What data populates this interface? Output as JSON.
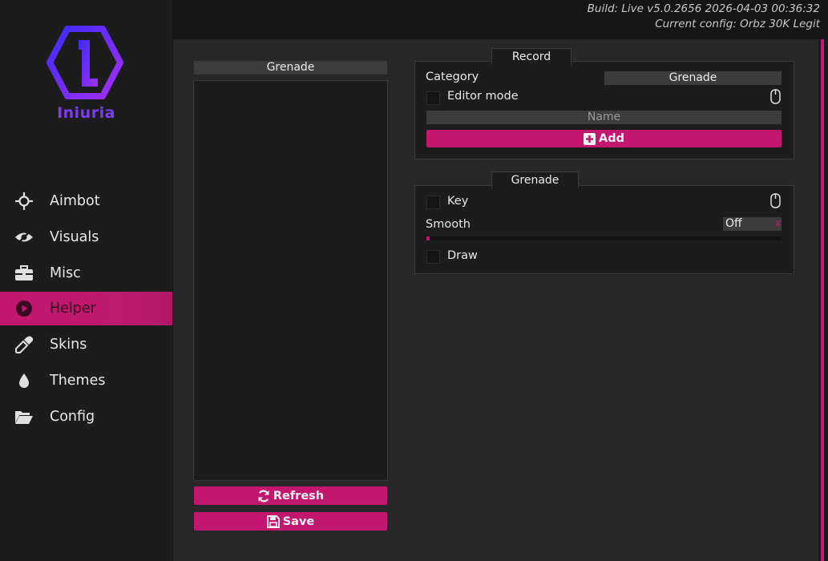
{
  "header": {
    "build_line": "Build: Live v5.0.2656 2026-04-03 00:36:32",
    "config_line": "Current config: Orbz 30K Legit"
  },
  "brand": {
    "name": "Iniuria",
    "color": "#7b3df0"
  },
  "accent_color": "#c2166f",
  "sidebar": {
    "items": [
      {
        "label": "Aimbot",
        "icon": "crosshair-icon"
      },
      {
        "label": "Visuals",
        "icon": "eye-icon"
      },
      {
        "label": "Misc",
        "icon": "toolbox-icon"
      },
      {
        "label": "Helper",
        "icon": "play-circle-icon",
        "active": true
      },
      {
        "label": "Skins",
        "icon": "eyedropper-icon"
      },
      {
        "label": "Themes",
        "icon": "droplet-icon"
      },
      {
        "label": "Config",
        "icon": "folder-open-icon"
      }
    ]
  },
  "left_panel": {
    "list_header": "Grenade",
    "refresh_label": "Refresh",
    "save_label": "Save"
  },
  "record": {
    "tab_label": "Record",
    "category_label": "Category",
    "category_value": "Grenade",
    "editor_mode_label": "Editor mode",
    "name_placeholder": "Name",
    "add_label": "Add"
  },
  "grenade": {
    "tab_label": "Grenade",
    "key_label": "Key",
    "smooth_label": "Smooth",
    "smooth_value": "Off",
    "smooth_clear": "x",
    "smooth_level": 0,
    "draw_label": "Draw"
  }
}
